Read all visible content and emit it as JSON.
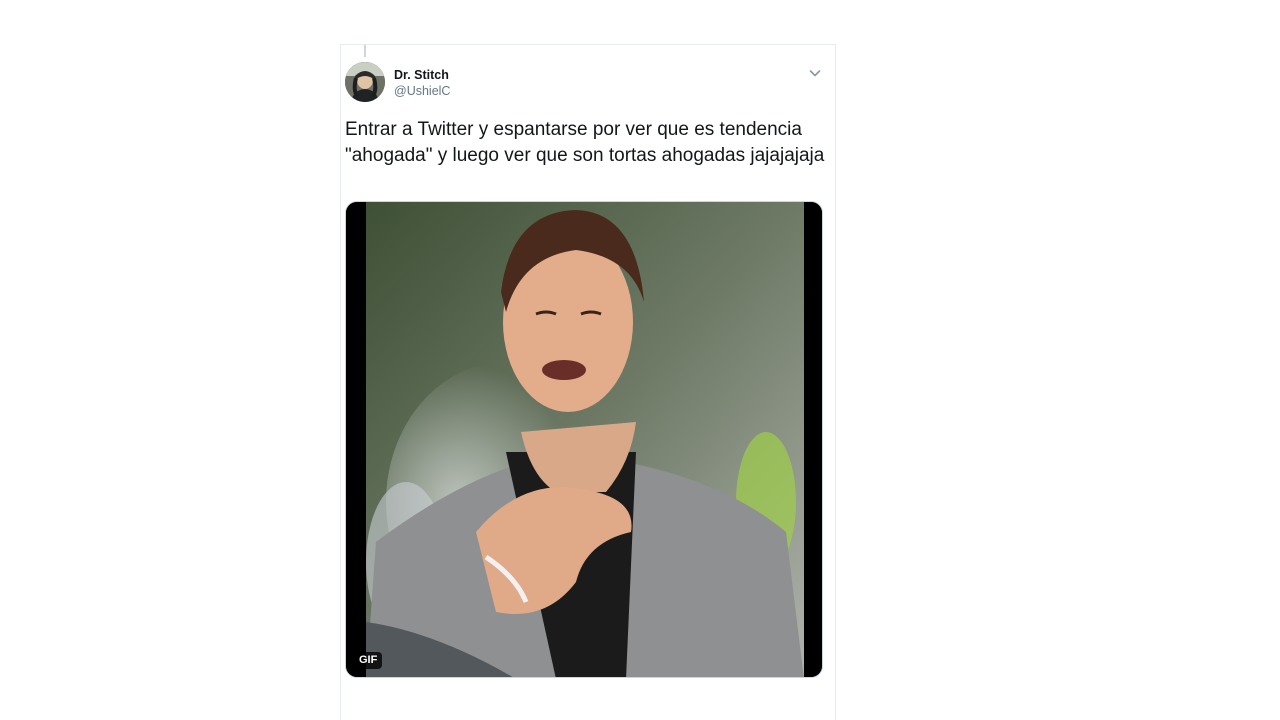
{
  "tweet": {
    "author": {
      "display_name": "Dr. Stitch",
      "handle": "@UshielC"
    },
    "text": "Entrar a Twitter y espantarse por ver que es tendencia \"ahogada\" y luego ver que son tortas ahogadas jajajajaja",
    "media": {
      "type": "gif",
      "badge_label": "GIF",
      "description_icon": "animated-gif"
    }
  },
  "colors": {
    "text_primary": "#14171a",
    "text_secondary": "#657786",
    "border": "#e6ecf0",
    "thread_line": "#ccd6dd"
  },
  "icons": {
    "menu": "chevron-down-icon"
  }
}
